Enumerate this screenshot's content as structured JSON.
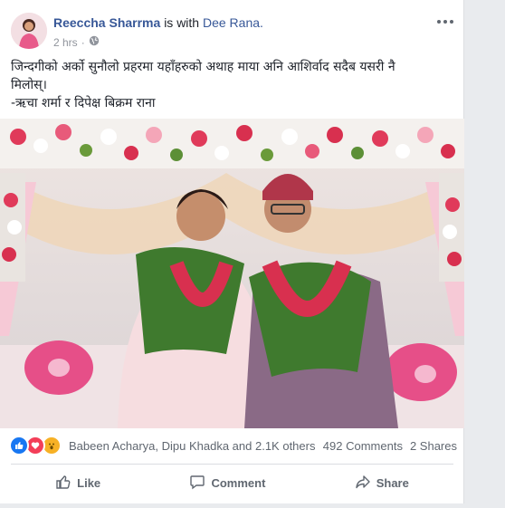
{
  "post": {
    "author": "Reeccha Sharrma",
    "with_text": "is with",
    "tagged": "Dee Rana.",
    "time": "2 hrs",
    "privacy_icon": "globe-icon",
    "text_line1": "जिन्दगीको अर्को सुनौलो प्रहरमा यहाँहरुको अथाह माया अनि आशिर्वाद सदैब यसरी नै",
    "text_line2": "मिलोस्।",
    "text_line3": "-ऋचा शर्मा र दिपेक्ष बिक्रम राना"
  },
  "reactions": {
    "icons": [
      "like-icon",
      "love-icon",
      "wow-icon"
    ],
    "names": "Babeen Acharya, Dipu Khadka and 2.1K others",
    "comments": "492 Comments",
    "shares": "2 Shares"
  },
  "actions": {
    "like": "Like",
    "comment": "Comment",
    "share": "Share"
  },
  "colors": {
    "link": "#385898",
    "text": "#1d2129",
    "muted": "#606770",
    "like_blue": "#1877f2",
    "love_red": "#f33e58",
    "wow_yellow": "#f7b125"
  }
}
